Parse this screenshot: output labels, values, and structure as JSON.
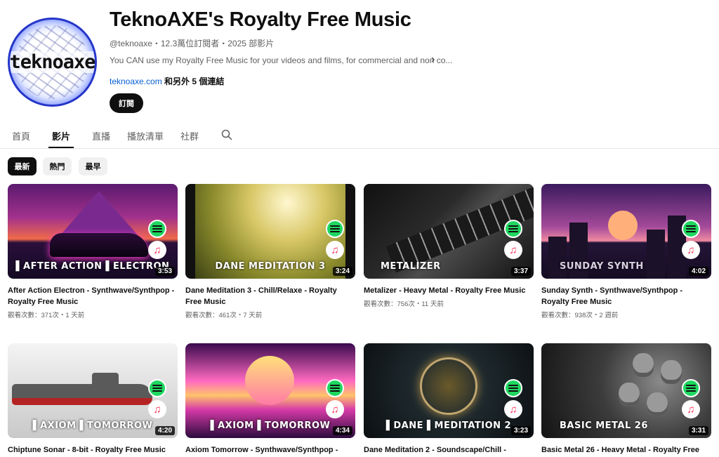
{
  "channel": {
    "title": "TeknoAXE's Royalty Free Music",
    "avatar_text": "teknoaxe",
    "meta": "@teknoaxe・12.3萬位訂閱者・2025 部影片",
    "description": "You CAN use my Royalty Free Music for your videos and films, for commercial and non co...",
    "link_site": "teknoaxe.com",
    "link_more": " 和另外 5 個連結",
    "subscribe_label": "訂閱"
  },
  "tabs": [
    {
      "label": "首頁"
    },
    {
      "label": "影片"
    },
    {
      "label": "直播"
    },
    {
      "label": "播放清單"
    },
    {
      "label": "社群"
    }
  ],
  "active_tab": "影片",
  "chips": [
    {
      "label": "最新",
      "active": true
    },
    {
      "label": "熱門",
      "active": false
    },
    {
      "label": "最早",
      "active": false
    }
  ],
  "colors": {
    "spotify": "#1ed760",
    "apple_music": "#fa2d55",
    "link": "#065fd4"
  },
  "videos": [
    {
      "thumb_text": "▌AFTER ACTION ▌ELECTRON",
      "duration": "3:53",
      "title": "After Action Electron - Synthwave/Synthpop - Royalty Free Music",
      "stats": "觀看次數：371次・1 天前"
    },
    {
      "thumb_text": "DANE MEDITATION 3",
      "duration": "3:24",
      "title": "Dane Meditation 3 - Chill/Relaxe - Royalty Free Music",
      "stats": "觀看次數：461次・7 天前"
    },
    {
      "thumb_text": "METALIZER",
      "duration": "3:37",
      "title": "Metalizer - Heavy Metal - Royalty Free Music",
      "stats": "觀看次數：756次・11 天前"
    },
    {
      "thumb_text": "SUNDAY SYNTH",
      "duration": "4:02",
      "title": "Sunday Synth - Synthwave/Synthpop - Royalty Free Music",
      "stats": "觀看次數：938次・2 週前"
    },
    {
      "thumb_text": "▌AXIOM ▌TOMORROW",
      "duration": "4:20",
      "title": "Chiptune Sonar - 8-bit - Royalty Free Music",
      "stats": ""
    },
    {
      "thumb_text": "▌AXIOM ▌TOMORROW",
      "duration": "4:34",
      "title": "Axiom Tomorrow - Synthwave/Synthpop -",
      "stats": ""
    },
    {
      "thumb_text": "▌DANE ▌MEDITATION 2",
      "duration": "3:23",
      "title": "Dane Meditation 2 - Soundscape/Chill -",
      "stats": ""
    },
    {
      "thumb_text": "BASIC METAL 26",
      "duration": "3:31",
      "title": "Basic Metal 26 - Heavy Metal - Royalty Free",
      "stats": ""
    }
  ]
}
